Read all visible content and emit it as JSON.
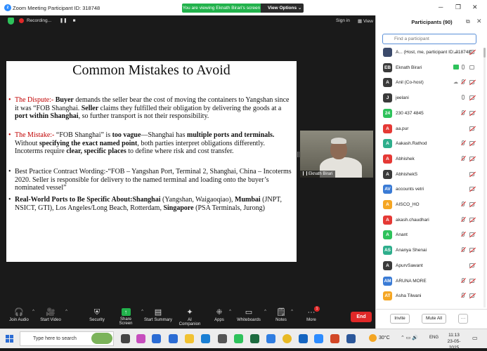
{
  "window": {
    "title": "Zoom Meeting Participant ID: 318748",
    "viewing_banner": "You are viewing Eknath Birari's screen",
    "view_options": "View Options"
  },
  "topbar": {
    "recording": "Recording...",
    "sign_in": "Sign in",
    "view": "View"
  },
  "slide": {
    "title": "Common Mistakes to Avoid",
    "b1_label": "The Dispute:-",
    "b1_t1": " ",
    "b1_buyer": "Buyer",
    "b1_t2": " demands the seller bear the cost of moving the containers to Yangshan since it was “FOB Shanghai. ",
    "b1_seller": "Seller",
    "b1_t3": " claims they fulfilled their obligation by delivering the goods at a ",
    "b1_port": "port within Shanghai",
    "b1_t4": ", so further transport is not their responsibility.",
    "b2_label": "The Mistake:-",
    "b2_t1": " “FOB Shanghai” is ",
    "b2_vague": "too vague",
    "b2_t2": "—Shanghai has ",
    "b2_multi": "multiple ports and terminals.",
    "b2_t3": " Without ",
    "b2_spec": "specifying the exact named point",
    "b2_t4": ", both parties interpret obligations differently. Incoterms require ",
    "b2_clear": "clear, specific places",
    "b2_t5": " to define where risk and cost transfer.",
    "b3_text": "Best Practice Contract Wording:-“FOB – Yangshan Port, Terminal 2, Shanghai, China – Incoterms 2020. Seller is responsible for delivery to the named terminal and loading onto the buyer’s nominated vessel”",
    "b4_lead": "Real-World Ports to Be Specific About:Shanghai",
    "b4_t1": " (Yangshan, Waigaoqiao), ",
    "b4_mumbai": "Mumbai",
    "b4_t2": " (JNPT, NSICT, GTI), Los Angeles/Long Beach, Rotterdam, ",
    "b4_singapore": "Singapore",
    "b4_t3": " (PSA Terminals, Jurong)"
  },
  "video_tile": {
    "name": "Eknath Birari"
  },
  "toolbar": {
    "join_audio": "Join Audio",
    "start_video": "Start Video",
    "security": "Security",
    "share_screen": "Share Screen",
    "start_summary": "Start Summary",
    "ai_companion": "AI Companion",
    "apps": "Apps",
    "whiteboards": "Whiteboards",
    "notes": "Notes",
    "more": "More",
    "more_badge": "1",
    "end": "End"
  },
  "participants": {
    "title": "Participants (90)",
    "search_placeholder": "Find a participant",
    "list": [
      {
        "initials": "",
        "name": "A... (Host, me, participant ID: 318748)",
        "color": "#3b4a6b"
      },
      {
        "initials": "EB",
        "name": "Eknath Birari",
        "color": "#3a3a3a"
      },
      {
        "initials": "A",
        "name": "Anil (Co-host)",
        "color": "#3a3a3a"
      },
      {
        "initials": "J",
        "name": "jeelani",
        "color": "#3a3a3a"
      },
      {
        "initials": "24",
        "name": "230 437 4845",
        "color": "#2ec25b"
      },
      {
        "initials": "A",
        "name": "aa.pur",
        "color": "#e53935"
      },
      {
        "initials": "A",
        "name": "Aakash.Rathod",
        "color": "#2eae8c"
      },
      {
        "initials": "A",
        "name": "Abhishek",
        "color": "#e53935"
      },
      {
        "initials": "A",
        "name": "AbhishekS",
        "color": "#3a3a3a"
      },
      {
        "initials": "AV",
        "name": "accounts vetri",
        "color": "#3a7bd5"
      },
      {
        "initials": "A",
        "name": "AISCO_HO",
        "color": "#f5a623"
      },
      {
        "initials": "A",
        "name": "akash.chaudhari",
        "color": "#e53935"
      },
      {
        "initials": "A",
        "name": "Anant",
        "color": "#2ec25b"
      },
      {
        "initials": "AS",
        "name": "Ananya Shenai",
        "color": "#2eae8c"
      },
      {
        "initials": "A",
        "name": "ApurvSawant",
        "color": "#3a3a3a"
      },
      {
        "initials": "AM",
        "name": "ARUNA MORE",
        "color": "#3a7bd5"
      },
      {
        "initials": "AT",
        "name": "Asha Tilwani",
        "color": "#f5a623"
      }
    ],
    "invite": "Invite",
    "mute_all": "Mute All",
    "more": "···"
  },
  "taskbar": {
    "search_placeholder": "Type here to search",
    "temperature": "30°C",
    "lang": "ENG",
    "time": "11:13",
    "date": "23-05-2025"
  }
}
